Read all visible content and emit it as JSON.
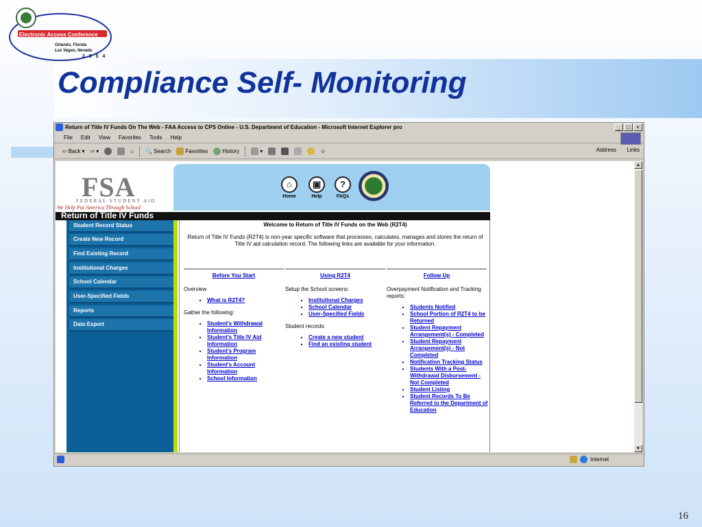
{
  "slide": {
    "title": "Compliance Self- Monitoring",
    "number": "16",
    "logo": {
      "conference": "Electronic Access Conference",
      "city": "Orlando, Florida",
      "state": "Las Vegas, Nevada",
      "year": "2 0 0 4"
    }
  },
  "browser": {
    "window_title": "Return of Title IV Funds On The Web - FAA Access to CPS Online - U.S. Department of Education - Microsoft Internet Explorer pro",
    "controls": {
      "minimize": "_",
      "restore": "□",
      "close": "×"
    },
    "menu": [
      "File",
      "Edit",
      "View",
      "Favorites",
      "Tools",
      "Help"
    ],
    "toolbar": {
      "back": "Back",
      "search": "Search",
      "favorites": "Favorites",
      "history": "History"
    },
    "address_label": "Address",
    "links_label": "Links",
    "status_zone": "Internet"
  },
  "page": {
    "fsa": {
      "logo": "FSA",
      "subtitle": "FEDERAL STUDENT AID",
      "tagline": "We Help Put America Through School"
    },
    "nav_icons": [
      {
        "label": "Home",
        "icon": "home-icon"
      },
      {
        "label": "Help",
        "icon": "help-icon"
      },
      {
        "label": "FAQs",
        "icon": "faq-icon"
      }
    ],
    "section_title": "Return of Title IV Funds",
    "left_nav": [
      "Student Record Status",
      "Create New Record",
      "Find Existing Record",
      "Institutional Charges",
      "School Calendar",
      "User-Specified Fields",
      "Reports",
      "Data Export"
    ],
    "welcome": "Welcome to Return of Title IV Funds on the Web (R2T4)",
    "intro": "Return of Title IV Funds (R2T4) is non-year specific software that processes, calculates, manages and stores the return of Title IV aid calculation record. The following links are available for your information.",
    "columns": [
      {
        "heading": "Before You Start",
        "p1": "Overview",
        "links1": [
          "What is R2T4?"
        ],
        "p2": "Gather the following:",
        "links2": [
          "Student's Withdrawal Information",
          "Student's Title IV Aid Information",
          "Student's Program Information",
          "Student's Account Information",
          "School Information"
        ]
      },
      {
        "heading": "Using R2T4",
        "p1": "Setup the School screens:",
        "links1": [
          "Institutional Charges",
          "School Calendar",
          "User-Specified Fields"
        ],
        "p2": "Student records:",
        "links2": [
          "Create a new student",
          "Find an existing student"
        ]
      },
      {
        "heading": "Follow Up",
        "p1": "Overpayment Notification and Tracking reports:",
        "links1": [
          "Students Notified",
          "School Portion of R2T4 to be Returned",
          "Student Repayment Arrangement(s) - Completed",
          "Student Repayment Arrangement(s) - Not Completed",
          "Notification Tracking Status",
          "Students With a Post-Withdrawal Disbursement - Not Completed",
          "Student Listing",
          "Student Records To Be Referred to the Department of Education"
        ]
      }
    ]
  },
  "colors": {
    "title": "#10329a",
    "nav_bg": "#0a5f97",
    "link": "#0000cc",
    "stripe": "#b7e000"
  }
}
